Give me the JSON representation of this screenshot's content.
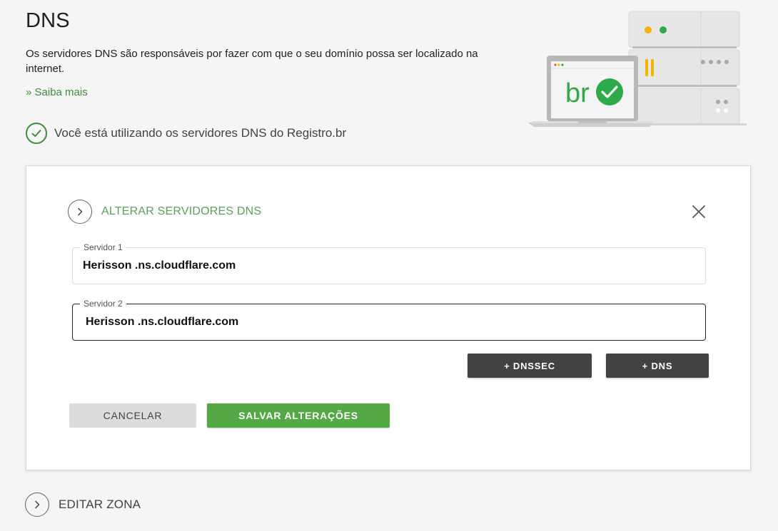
{
  "header": {
    "title": "DNS",
    "description": "Os servidores DNS são responsáveis por fazer com que o seu domínio possa ser localizado na internet.",
    "learn_more": "» Saiba mais",
    "status_text": "Você está utilizando os servidores DNS do Registro.br"
  },
  "illustration": {
    "logo_text": "br"
  },
  "dns_panel": {
    "title": "ALTERAR SERVIDORES DNS",
    "servers": [
      {
        "label": "Servidor 1",
        "value": "Herisson .ns.cloudflare.com"
      },
      {
        "label": "Servidor 2",
        "value": "Herisson .ns.cloudflare.com"
      }
    ],
    "buttons": {
      "dnssec": "+ DNSSEC",
      "dns": "+ DNS",
      "cancel": "CANCELAR",
      "save": "SALVAR ALTERAÇÕES"
    }
  },
  "edit_zone": {
    "title": "EDITAR ZONA"
  },
  "colors": {
    "brand_green": "#55a846",
    "link_green": "#3c8c3c",
    "panel_title_green": "#5c9e5c",
    "dark_button": "#424242",
    "cancel_button": "#dcdcdc",
    "background": "#f5f5f5"
  },
  "icons": {
    "status": "check-circle-icon",
    "expand": "chevron-right-icon",
    "close": "close-icon"
  }
}
